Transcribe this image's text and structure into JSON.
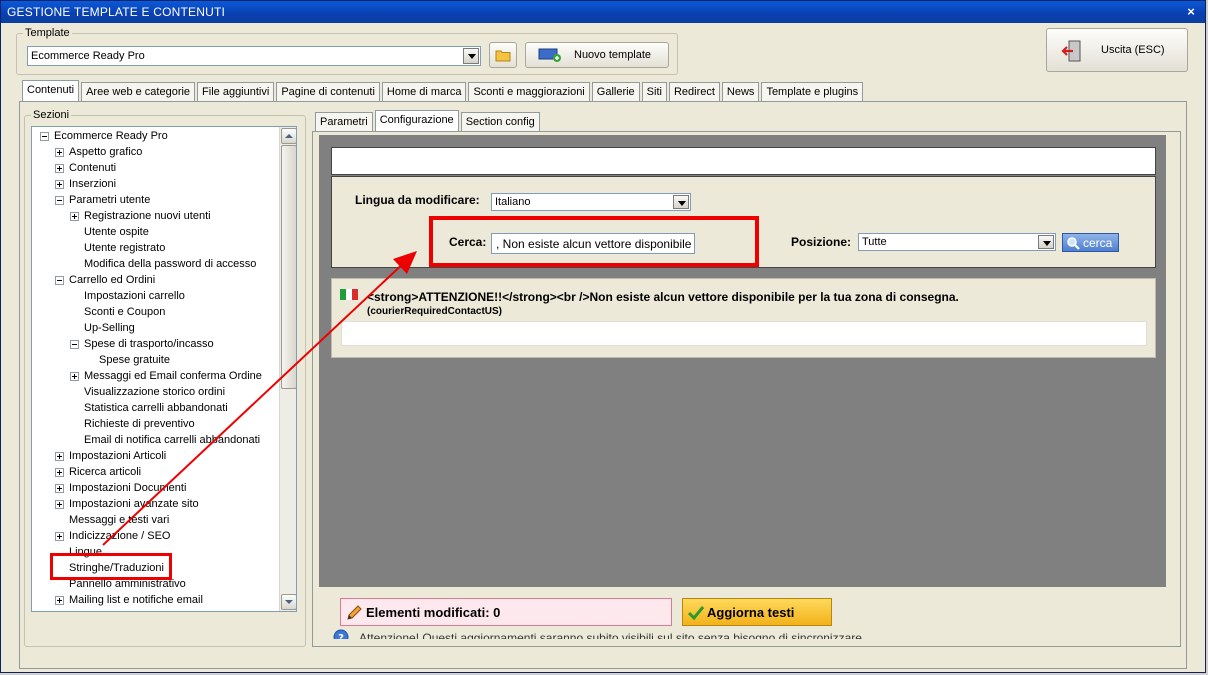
{
  "window": {
    "title": "GESTIONE TEMPLATE E CONTENUTI",
    "close_glyph": "×"
  },
  "template_group": {
    "legend": "Template",
    "selected": "Ecommerce Ready Pro",
    "new_template_label": "Nuovo template"
  },
  "exit_button": {
    "label": "Uscita (ESC)"
  },
  "main_tabs": [
    "Contenuti",
    "Aree web e categorie",
    "File aggiuntivi",
    "Pagine di contenuti",
    "Home di marca",
    "Sconti e maggiorazioni",
    "Gallerie",
    "Siti",
    "Redirect",
    "News",
    "Template e plugins"
  ],
  "sections": {
    "legend": "Sezioni",
    "tree": [
      {
        "label": "Ecommerce Ready Pro",
        "level": 0,
        "toggle": "minus"
      },
      {
        "label": "Aspetto grafico",
        "level": 1,
        "toggle": "plus"
      },
      {
        "label": "Contenuti",
        "level": 1,
        "toggle": "plus"
      },
      {
        "label": "Inserzioni",
        "level": 1,
        "toggle": "plus"
      },
      {
        "label": "Parametri utente",
        "level": 1,
        "toggle": "minus"
      },
      {
        "label": "Registrazione nuovi utenti",
        "level": 2,
        "toggle": "plus"
      },
      {
        "label": "Utente ospite",
        "level": 2,
        "toggle": ""
      },
      {
        "label": "Utente registrato",
        "level": 2,
        "toggle": ""
      },
      {
        "label": "Modifica della password di accesso",
        "level": 2,
        "toggle": ""
      },
      {
        "label": "Carrello ed Ordini",
        "level": 1,
        "toggle": "minus"
      },
      {
        "label": "Impostazioni carrello",
        "level": 2,
        "toggle": ""
      },
      {
        "label": "Sconti e Coupon",
        "level": 2,
        "toggle": ""
      },
      {
        "label": "Up-Selling",
        "level": 2,
        "toggle": ""
      },
      {
        "label": "Spese di trasporto/incasso",
        "level": 2,
        "toggle": "minus"
      },
      {
        "label": "Spese gratuite",
        "level": 3,
        "toggle": ""
      },
      {
        "label": "Messaggi ed Email conferma Ordine",
        "level": 2,
        "toggle": "plus"
      },
      {
        "label": "Visualizzazione storico ordini",
        "level": 2,
        "toggle": ""
      },
      {
        "label": "Statistica carrelli abbandonati",
        "level": 2,
        "toggle": ""
      },
      {
        "label": "Richieste di preventivo",
        "level": 2,
        "toggle": ""
      },
      {
        "label": "Email di notifica carrelli abbandonati",
        "level": 2,
        "toggle": ""
      },
      {
        "label": "Impostazioni Articoli",
        "level": 1,
        "toggle": "plus"
      },
      {
        "label": "Ricerca articoli",
        "level": 1,
        "toggle": "plus"
      },
      {
        "label": "Impostazioni Documenti",
        "level": 1,
        "toggle": "plus"
      },
      {
        "label": "Impostazioni avanzate sito",
        "level": 1,
        "toggle": "plus"
      },
      {
        "label": "Messaggi e testi vari",
        "level": 1,
        "toggle": ""
      },
      {
        "label": "Indicizzazione / SEO",
        "level": 1,
        "toggle": "plus"
      },
      {
        "label": "Lingue",
        "level": 1,
        "toggle": ""
      },
      {
        "label": "Stringhe/Traduzioni",
        "level": 1,
        "toggle": ""
      },
      {
        "label": "Pannello amministrativo",
        "level": 1,
        "toggle": ""
      },
      {
        "label": "Mailing list e notifiche email",
        "level": 1,
        "toggle": "plus"
      }
    ]
  },
  "sub_tabs": [
    "Parametri",
    "Configurazione",
    "Section config"
  ],
  "config": {
    "lingua_label": "Lingua da modificare:",
    "lingua_value": "Italiano",
    "cerca_label": "Cerca:",
    "cerca_value": ", Non esiste alcun vettore disponibile",
    "posizione_label": "Posizione:",
    "posizione_value": "Tutte",
    "cerca_button": "cerca"
  },
  "result": {
    "text": "<strong>ATTENZIONE!!</strong><br />Non esiste alcun vettore disponibile per la tua zona di consegna.",
    "key": "(courierRequiredContactUS)"
  },
  "footer": {
    "modified_label": "Elementi modificati: 0",
    "update_button": "Aggiorna testi",
    "warning": "Attenzione! Questi aggiornamenti saranno subito visibili sul sito senza bisogno di sincronizzare"
  },
  "colors": {
    "highlight_red": "#ee0000",
    "gray_area": "#808080",
    "update_button": "#f6c32a",
    "modified_bg": "#fde8ee"
  }
}
